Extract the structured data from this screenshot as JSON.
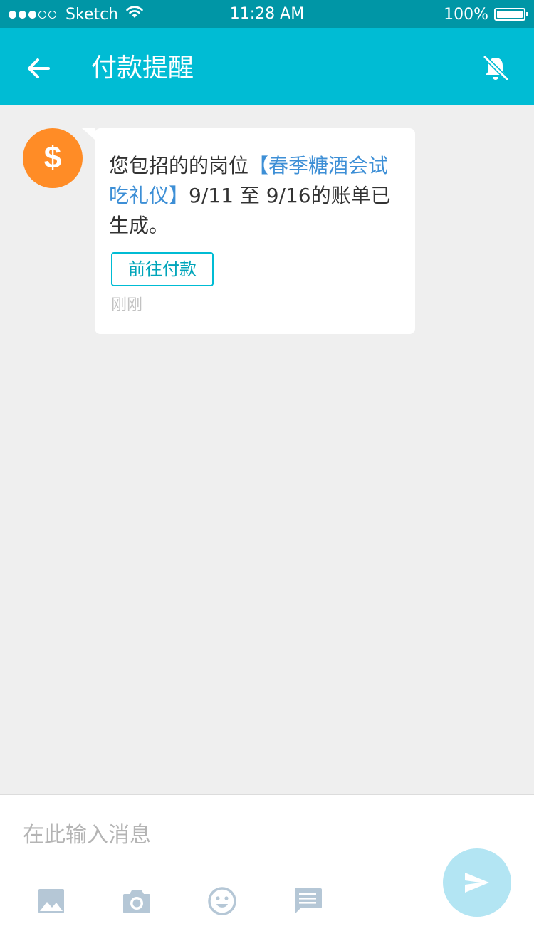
{
  "status_bar": {
    "carrier": "Sketch",
    "time": "11:28 AM",
    "battery": "100%",
    "signal_bars_filled": 3,
    "signal_bars_total": 5
  },
  "nav": {
    "title": "付款提醒",
    "back_icon": "arrow-left-icon",
    "right_icon": "bell-off-icon"
  },
  "message": {
    "avatar_symbol": "$",
    "text_before": "您包招的的岗位",
    "text_highlight": "【春季糖酒会试吃礼仪】",
    "text_after": "9/11 至 9/16的账单已生成。",
    "action_label": "前往付款",
    "time": "刚刚"
  },
  "composer": {
    "placeholder": "在此输入消息",
    "tools": [
      "image-icon",
      "camera-icon",
      "emoji-icon",
      "quick-reply-icon"
    ],
    "send_icon": "send-icon"
  },
  "colors": {
    "status_bar": "#0096a6",
    "nav_bar": "#00bcd4",
    "avatar": "#ff8c26",
    "highlight": "#3d8fd6",
    "send_button": "#b3e5f3",
    "tool_icon": "#b5c7d6"
  }
}
